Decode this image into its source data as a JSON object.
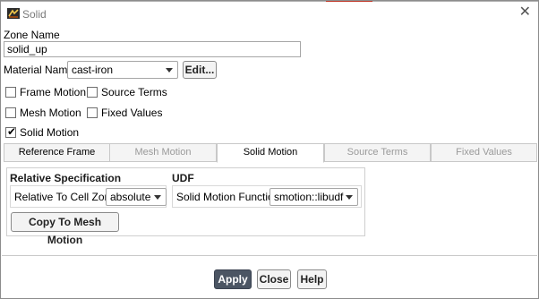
{
  "window": {
    "title": "Solid",
    "close_glyph": "✕"
  },
  "zone": {
    "label": "Zone Name",
    "value": "solid_up"
  },
  "material": {
    "label": "Material Name",
    "selected": "cast-iron",
    "edit_label": "Edit..."
  },
  "options": {
    "frame_motion": {
      "label": "Frame Motion",
      "checked": false
    },
    "source_terms": {
      "label": "Source Terms",
      "checked": false
    },
    "mesh_motion": {
      "label": "Mesh Motion",
      "checked": false
    },
    "fixed_values": {
      "label": "Fixed Values",
      "checked": false
    },
    "solid_motion": {
      "label": "Solid Motion",
      "checked": true,
      "tick": "✔"
    }
  },
  "tabs": [
    {
      "label": "Reference Frame",
      "state": "enabled"
    },
    {
      "label": "Mesh Motion",
      "state": "disabled"
    },
    {
      "label": "Solid Motion",
      "state": "active"
    },
    {
      "label": "Source Terms",
      "state": "disabled"
    },
    {
      "label": "Fixed Values",
      "state": "disabled"
    }
  ],
  "relative_spec": {
    "title": "Relative Specification",
    "label": "Relative To Cell Zone",
    "selected": "absolute"
  },
  "udf": {
    "title": "UDF",
    "label": "Solid Motion Function",
    "selected": "smotion::libudf"
  },
  "copy_button": "Copy To Mesh Motion",
  "footer": {
    "apply": "Apply",
    "close": "Close",
    "help": "Help"
  },
  "colors": {
    "primary_button": "#4b5563",
    "disabled_tab_text": "#9a9a9a",
    "title_text": "#7a7a7a"
  },
  "icons": {
    "app": "fluent-app-icon",
    "close": "close-icon",
    "dropdown": "chevron-down-icon",
    "check": "check-icon"
  }
}
